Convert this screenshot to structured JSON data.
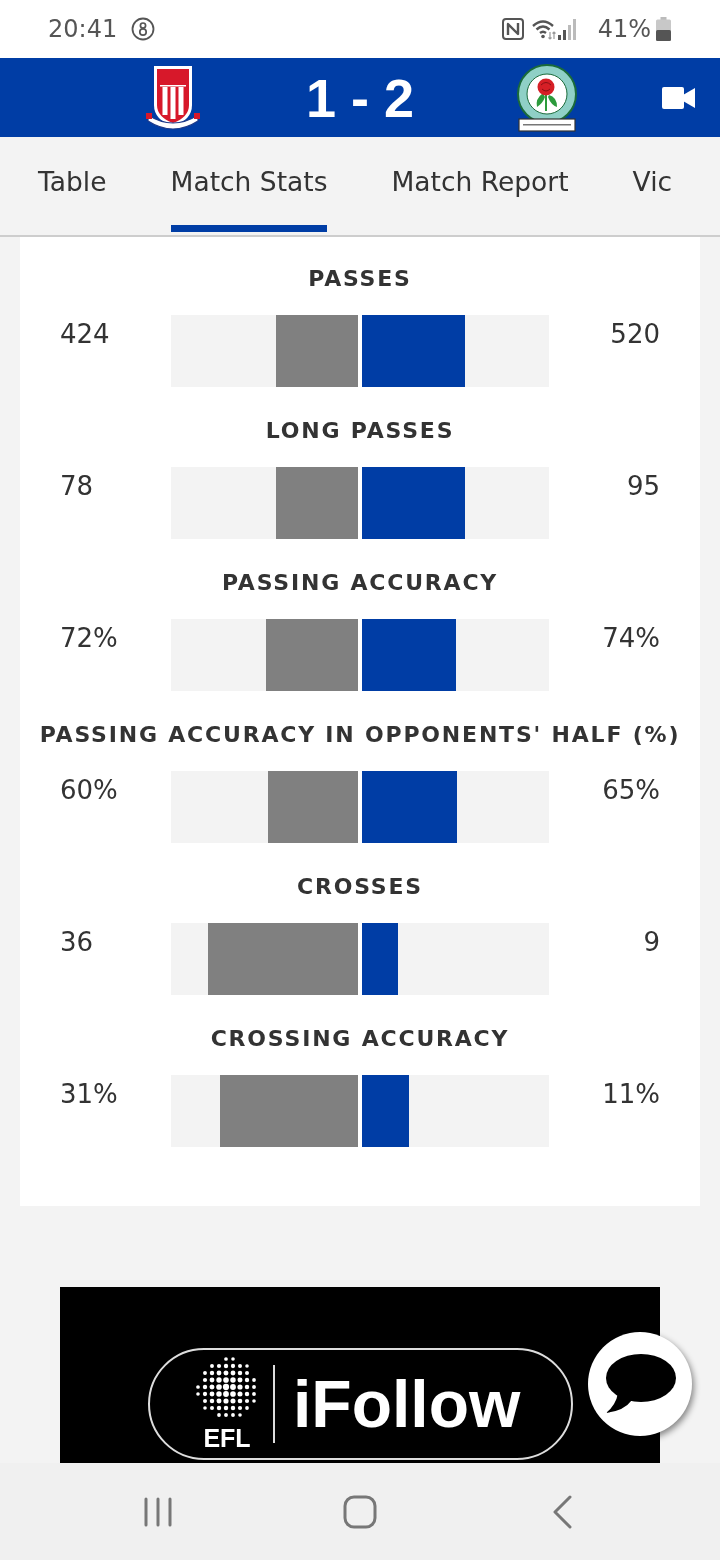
{
  "status_bar": {
    "time": "20:41",
    "battery": "41%"
  },
  "header": {
    "score": "1 - 2"
  },
  "tabs": [
    {
      "label": "Table",
      "selected": false
    },
    {
      "label": "Match Stats",
      "selected": true
    },
    {
      "label": "Match Report",
      "selected": false
    },
    {
      "label": "Vic",
      "selected": false
    }
  ],
  "stats": [
    {
      "title": "PASSES",
      "home": {
        "value": "424",
        "level": 0.44
      },
      "away": {
        "value": "520",
        "level": 0.55
      }
    },
    {
      "title": "LONG PASSES",
      "home": {
        "value": "78",
        "level": 0.44
      },
      "away": {
        "value": "95",
        "level": 0.55
      }
    },
    {
      "title": "PASSING ACCURACY",
      "home": {
        "value": "72%",
        "level": 0.49
      },
      "away": {
        "value": "74%",
        "level": 0.5
      }
    },
    {
      "title": "PASSING ACCURACY IN OPPONENTS' HALF (%)",
      "home": {
        "value": "60%",
        "level": 0.48
      },
      "away": {
        "value": "65%",
        "level": 0.51
      }
    },
    {
      "title": "CROSSES",
      "home": {
        "value": "36",
        "level": 0.8
      },
      "away": {
        "value": "9",
        "level": 0.19
      }
    },
    {
      "title": "CROSSING ACCURACY",
      "home": {
        "value": "31%",
        "level": 0.74
      },
      "away": {
        "value": "11%",
        "level": 0.25
      }
    }
  ],
  "ad_banner": {
    "badge_text": "EFL",
    "brand_text": "iFollow"
  }
}
